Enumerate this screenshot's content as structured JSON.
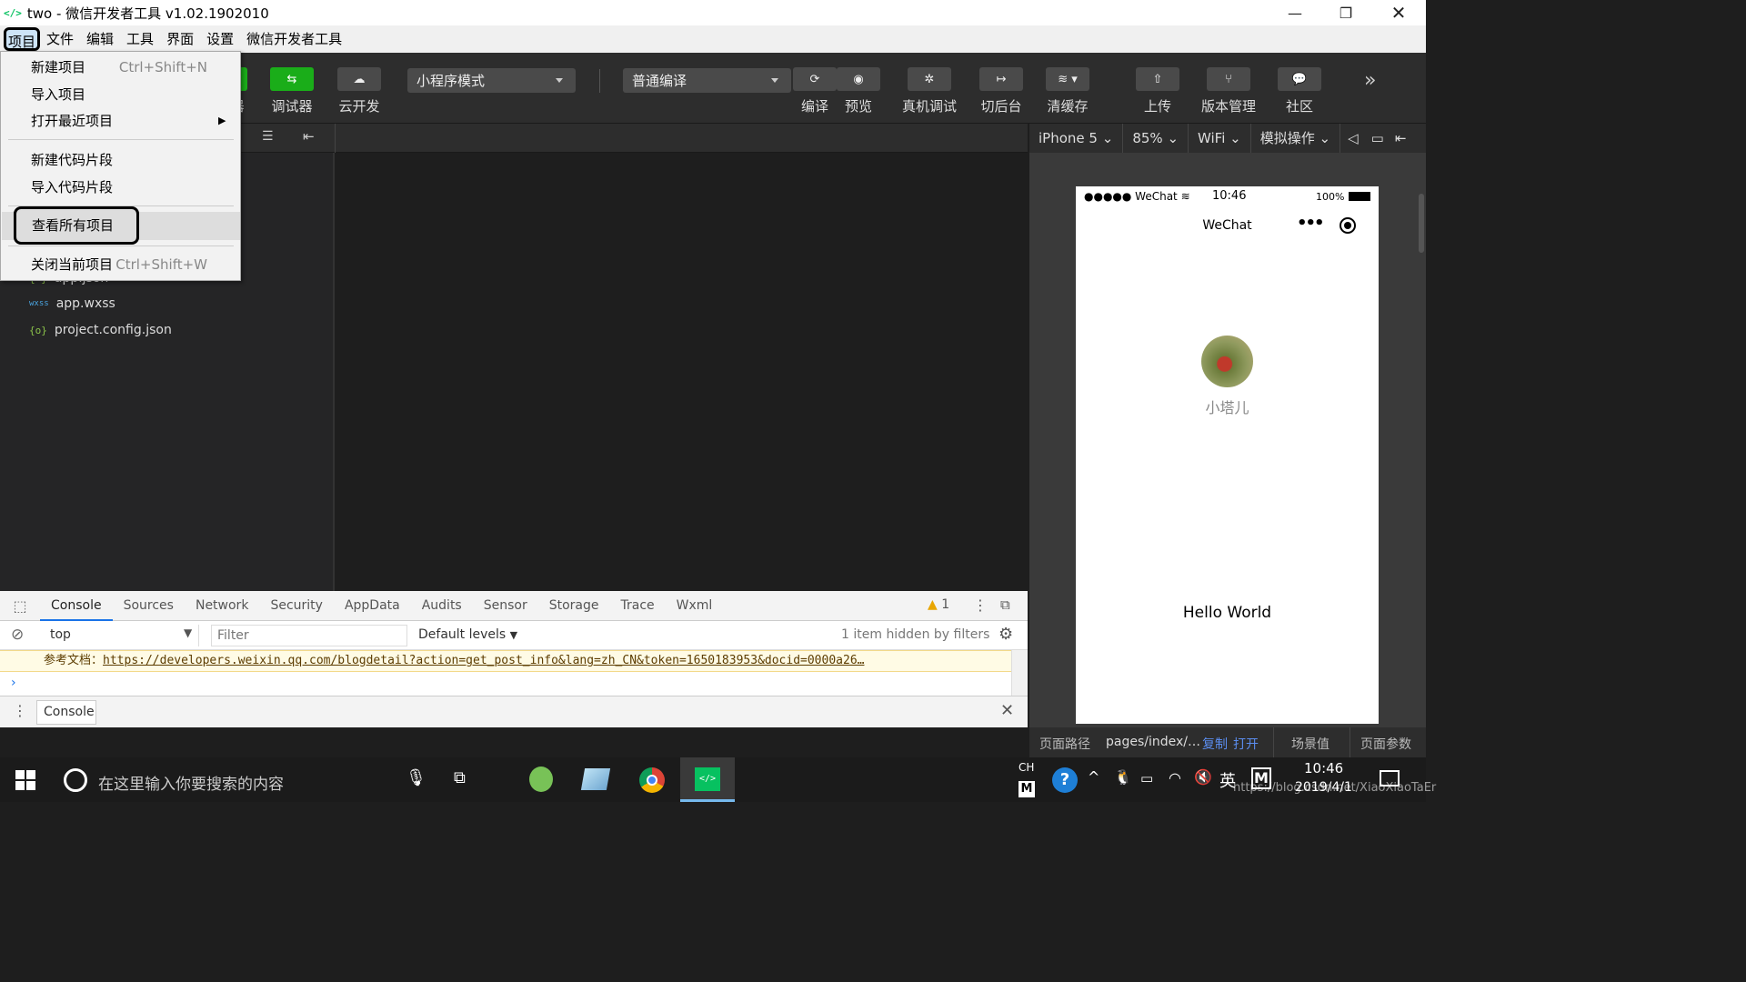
{
  "window": {
    "title": "two - 微信开发者工具 v1.02.1902010",
    "logo": "</>"
  },
  "menubar": [
    "项目",
    "文件",
    "编辑",
    "工具",
    "界面",
    "设置",
    "微信开发者工具"
  ],
  "toolbar": {
    "debugger": "调试器",
    "cloud": "云开发",
    "mode": "小程序模式",
    "compile_mode": "普通编译",
    "compile": "编译",
    "preview": "预览",
    "remote_debug": "真机调试",
    "background": "切后台",
    "clear_cache": "清缓存",
    "upload": "上传",
    "version": "版本管理",
    "community": "社区",
    "partial_label": "器"
  },
  "files": [
    {
      "icon": "{ }",
      "name": "app.json"
    },
    {
      "icon": "wxss",
      "name": "app.wxss"
    },
    {
      "icon": "{o}",
      "name": "project.config.json"
    }
  ],
  "project_menu": {
    "new_project": "新建项目",
    "new_project_shortcut": "Ctrl+Shift+N",
    "import_project": "导入项目",
    "open_recent": "打开最近项目",
    "new_snippet": "新建代码片段",
    "import_snippet": "导入代码片段",
    "view_all": "查看所有项目",
    "close_project": "关闭当前项目",
    "close_shortcut": "Ctrl+Shift+W"
  },
  "devtools": {
    "tabs": [
      "Console",
      "Sources",
      "Network",
      "Security",
      "AppData",
      "Audits",
      "Sensor",
      "Storage",
      "Trace",
      "Wxml"
    ],
    "warnings": "1",
    "context": "top",
    "filter_placeholder": "Filter",
    "levels": "Default levels",
    "hidden": "1 item hidden by filters",
    "warn_label": "参考文档：",
    "warn_link": "https://developers.weixin.qq.com/blogdetail?action=get_post_info&lang=zh_CN&token=1650183953&docid=0000a26…",
    "prompt": "›",
    "drawer_tab": "Console"
  },
  "simulator": {
    "device": "iPhone 5",
    "zoom": "85%",
    "network": "WiFi",
    "ops": "模拟操作",
    "carrier": "●●●●● WeChat",
    "time": "10:46",
    "battery": "100%",
    "nav_title": "WeChat",
    "nickname": "小塔儿",
    "hello": "Hello World"
  },
  "statusline": {
    "path_label": "页面路径",
    "path": "pages/index/…",
    "copy": "复制",
    "open": "打开",
    "scene": "场景值",
    "params": "页面参数"
  },
  "taskbar": {
    "search": "在这里输入你要搜索的内容",
    "ime_ch": "CH",
    "ime": "英",
    "time": "10:46",
    "date": "2019/4/1",
    "watermark": "https://blog.csdn.net/XiaoXiaoTaEr"
  },
  "colors": {
    "accent": "#1aad19",
    "link": "#5b8def"
  }
}
